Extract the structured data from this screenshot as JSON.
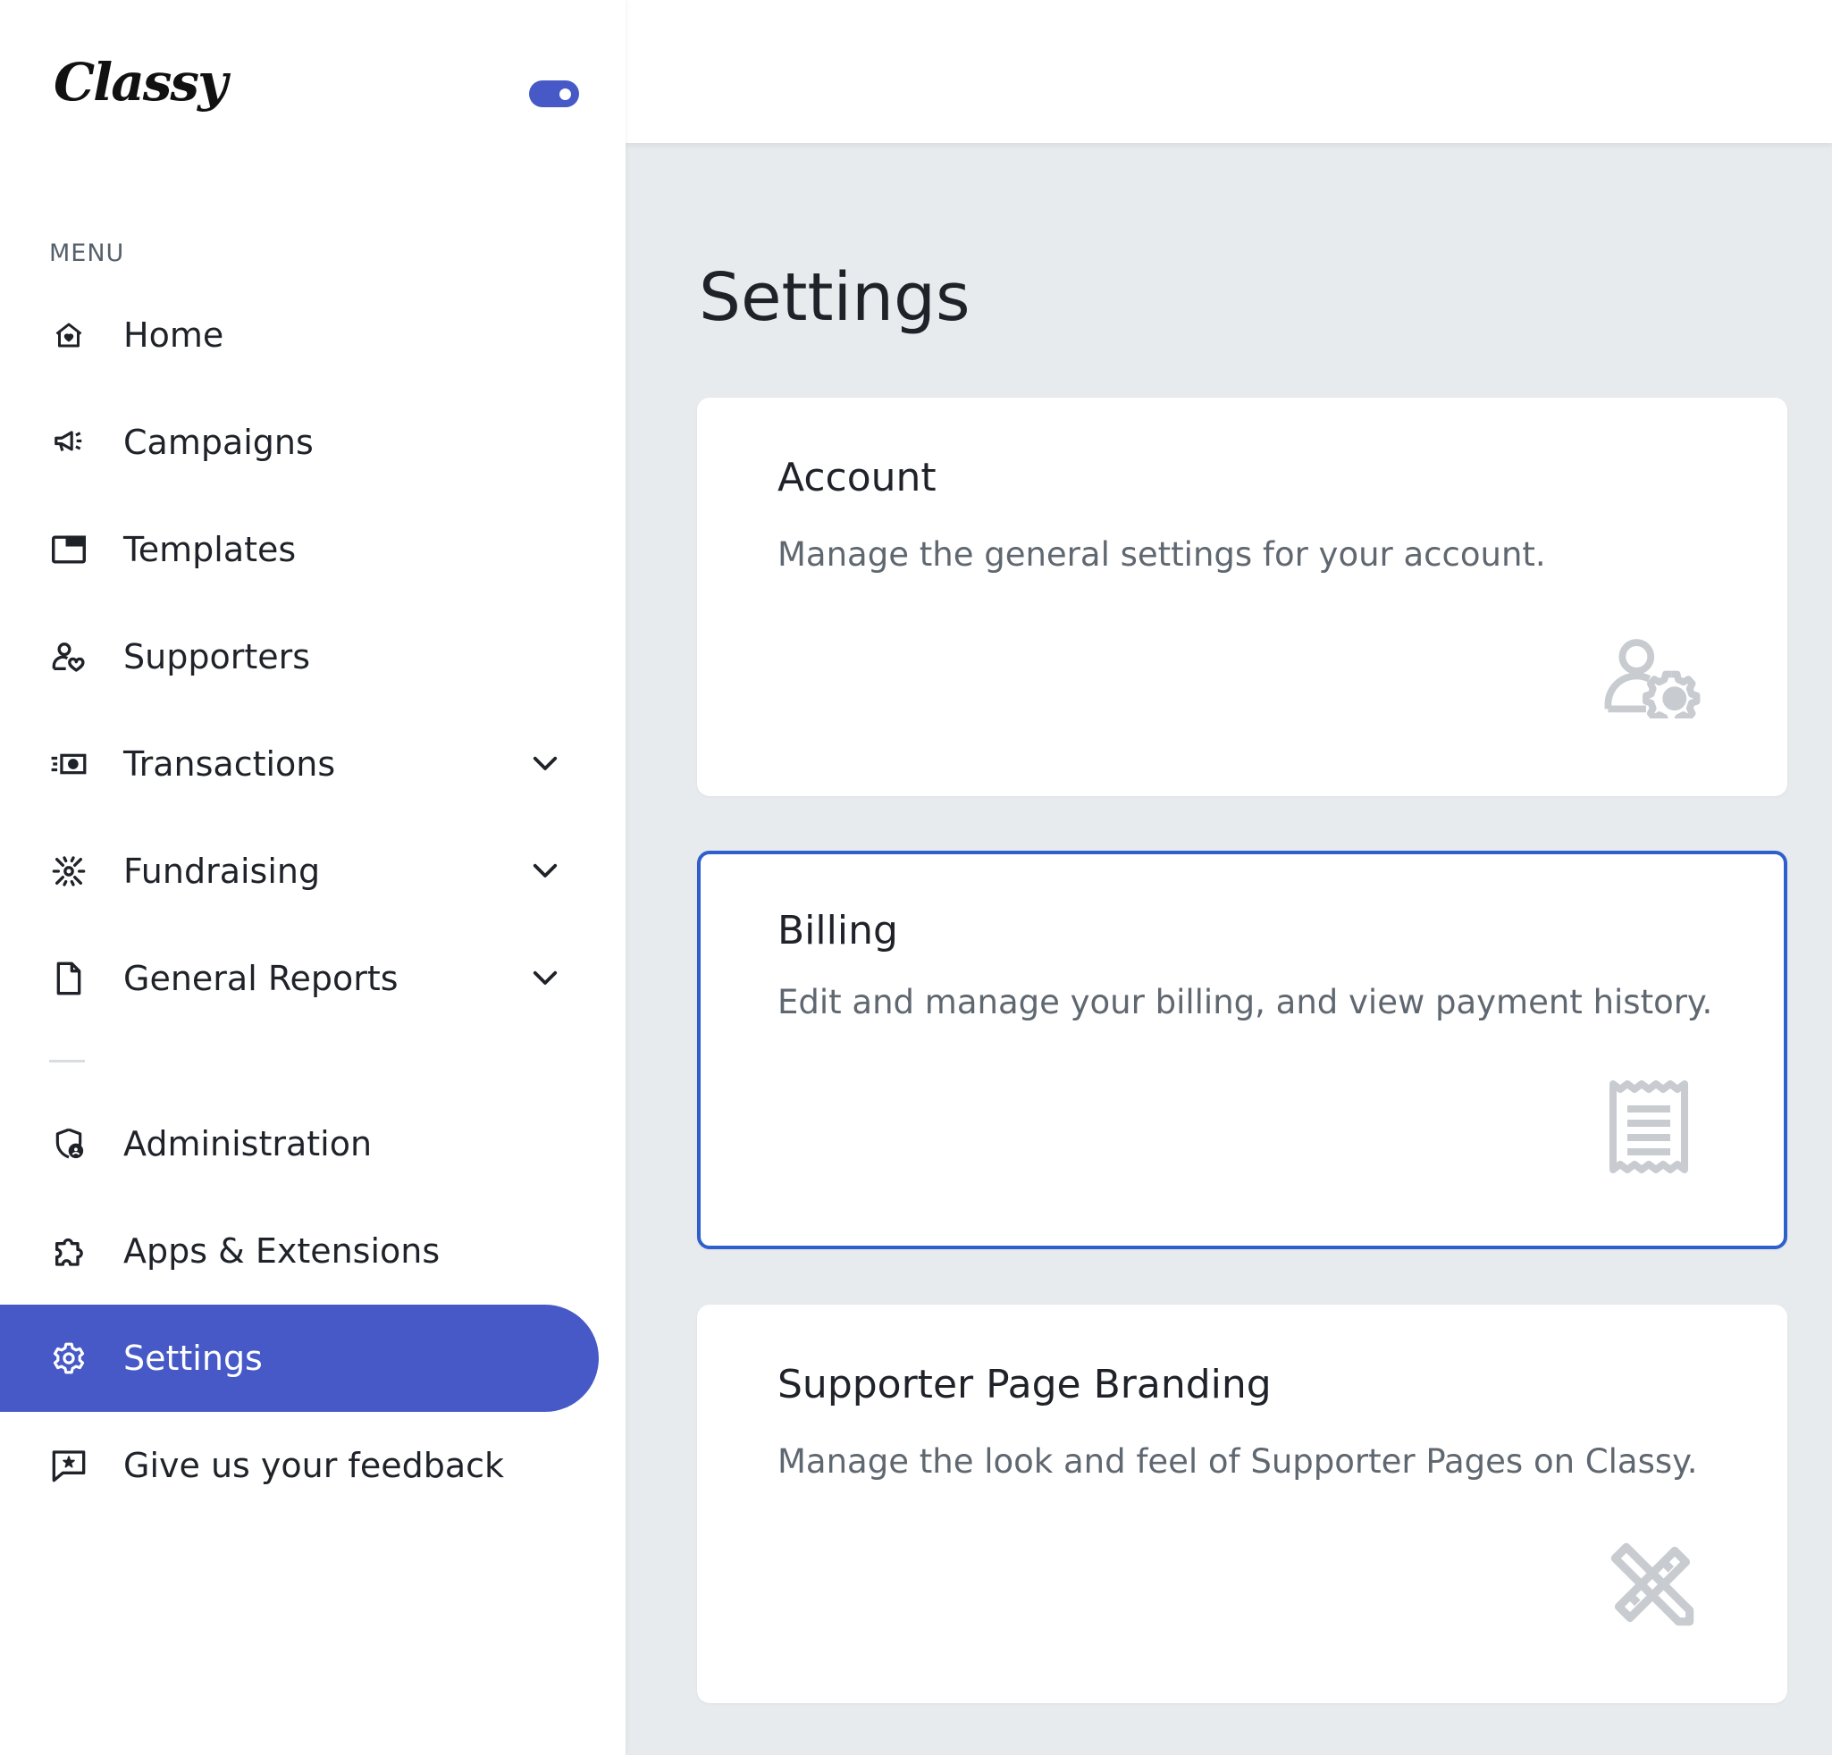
{
  "app": {
    "logo_text": "Classy"
  },
  "sidebar": {
    "menu_label": "MENU",
    "items": [
      {
        "label": "Home",
        "icon": "home-icon"
      },
      {
        "label": "Campaigns",
        "icon": "megaphone-icon"
      },
      {
        "label": "Templates",
        "icon": "window-icon"
      },
      {
        "label": "Supporters",
        "icon": "supporter-heart-icon"
      },
      {
        "label": "Transactions",
        "icon": "cash-icon",
        "expandable": true
      },
      {
        "label": "Fundraising",
        "icon": "sparkle-icon",
        "expandable": true
      },
      {
        "label": "General Reports",
        "icon": "document-icon",
        "expandable": true
      },
      {
        "label": "Administration",
        "icon": "shield-user-icon"
      },
      {
        "label": "Apps & Extensions",
        "icon": "puzzle-icon"
      },
      {
        "label": "Settings",
        "icon": "gear-icon",
        "active": true
      },
      {
        "label": "Give us your feedback",
        "icon": "feedback-icon"
      }
    ]
  },
  "main": {
    "title": "Settings",
    "cards": [
      {
        "title": "Account",
        "description": "Manage the general settings for your account.",
        "icon": "user-settings-icon"
      },
      {
        "title": "Billing",
        "description": "Edit and manage your billing, and view payment history.",
        "icon": "receipt-icon",
        "focused": true
      },
      {
        "title": "Supporter Page Branding",
        "description": "Manage the look and feel of Supporter Pages on Classy.",
        "icon": "design-tools-icon"
      }
    ]
  },
  "colors": {
    "accent": "#4659c7",
    "focus_border": "#2f5fcc",
    "main_background": "#e8ebee",
    "muted_icon": "#c8ccd0"
  }
}
